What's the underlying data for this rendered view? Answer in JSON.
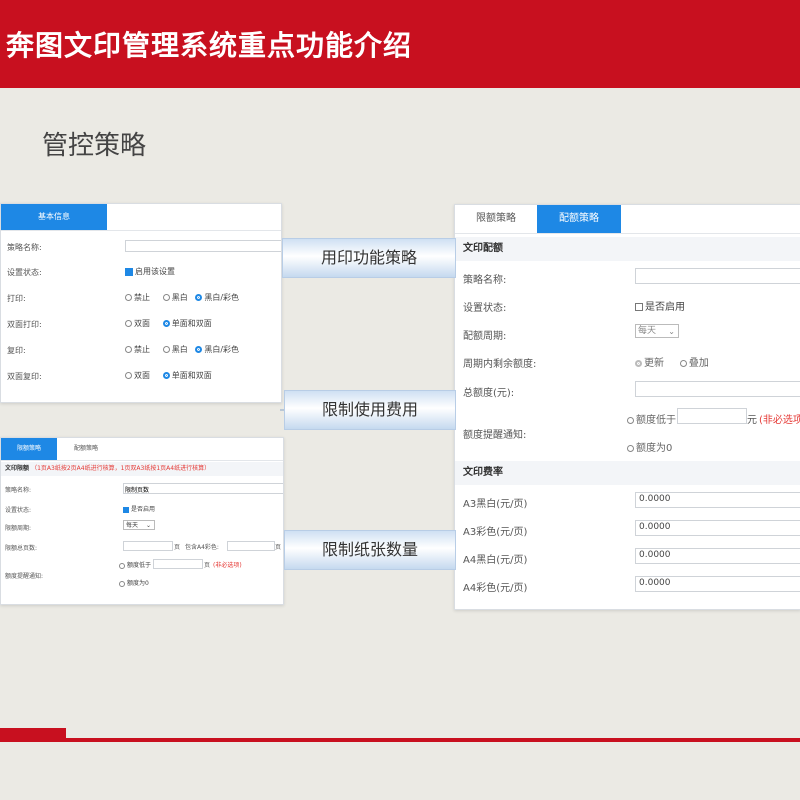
{
  "header": {
    "title": "奔图文印管理系统重点功能介绍"
  },
  "page_heading": "管控策略",
  "ribbons": {
    "function": "用印功能策略",
    "cost": "限制使用费用",
    "paper": "限制纸张数量"
  },
  "panel_basic": {
    "tab_basic": "基本信息",
    "rows": {
      "name_label": "策略名称:",
      "status_label": "设置状态:",
      "status_value": "启用该设置",
      "print_label": "打印:",
      "duplex_print_label": "双面打印:",
      "copy_label": "复印:",
      "duplex_copy_label": "双面复印:"
    },
    "options": {
      "forbid": "禁止",
      "bw": "黑白",
      "bw_color": "黑白/彩色",
      "duplex": "双面",
      "simplex_duplex": "单面和双面"
    }
  },
  "panel_quota_limit": {
    "tab_limit": "限额策略",
    "tab_quota": "配额策略",
    "section_title": "文印限额",
    "section_note": "（1页A3纸按2页A4纸进行核算，1页双A3纸按1页A4纸进行核算）",
    "name_label": "策略名称:",
    "name_value": "限制页数",
    "status_label": "设置状态:",
    "status_value": "是否启用",
    "period_label": "限额周期:",
    "period_value": "每天",
    "total_pages_label": "限额总页数:",
    "total_pages_unit": "页",
    "color_label": "包含A4彩色:",
    "color_unit": "页",
    "remind_label": "额度提醒通知:",
    "remind_low": "额度低于",
    "remind_unit": "页",
    "remind_required": "(非必选项)",
    "remind_zero": "额度为0"
  },
  "panel_quota": {
    "tab_limit": "限额策略",
    "tab_quota": "配额策略",
    "section_quota": "文印配额",
    "name_label": "策略名称:",
    "status_label": "设置状态:",
    "status_value": "是否启用",
    "period_label": "配额周期:",
    "period_value": "每天",
    "remaining_label": "周期内剩余额度:",
    "remaining_update": "更新",
    "remaining_add": "叠加",
    "total_label": "总额度(元):",
    "remind_label": "额度提醒通知:",
    "remind_low": "额度低于",
    "remind_unit": "元",
    "remind_required": "(非必选项)",
    "remind_zero": "额度为0",
    "section_rate": "文印费率",
    "rates": [
      {
        "label": "A3黑白(元/页)",
        "value": "0.0000"
      },
      {
        "label": "A3彩色(元/页)",
        "value": "0.0000"
      },
      {
        "label": "A4黑白(元/页)",
        "value": "0.0000"
      },
      {
        "label": "A4彩色(元/页)",
        "value": "0.0000"
      }
    ]
  },
  "colors": {
    "brand_red": "#c8101f",
    "tab_blue": "#1e88e5"
  }
}
